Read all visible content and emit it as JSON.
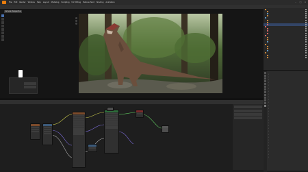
{
  "menubar": {
    "items": [
      "File",
      "Edit",
      "Render",
      "Window",
      "Help",
      "Layout",
      "Modeling",
      "Sculpting",
      "UV Editing",
      "Texture Paint",
      "Shading",
      "Animation"
    ]
  },
  "window_controls": {
    "minimize": "–",
    "maximize": "□",
    "close": "×"
  },
  "viewport": {
    "title": "Camera Perspective"
  },
  "minipanel": {
    "row1_label": "",
    "row2_value": "",
    "row3_value": ""
  },
  "node_editor": {
    "header_labels": [
      "",
      ""
    ]
  },
  "outliner": {
    "rows": [
      {
        "label": "",
        "color": "#d08b3b",
        "selected": false
      },
      {
        "label": "",
        "color": "#d08b3b",
        "selected": false
      },
      {
        "label": "",
        "color": "#5fa0d0",
        "selected": false
      },
      {
        "label": "",
        "color": "#d08b3b",
        "selected": false
      },
      {
        "label": "",
        "color": "#5fa0d0",
        "selected": false
      },
      {
        "label": "",
        "color": "#d08b3b",
        "selected": false
      },
      {
        "label": "",
        "color": "#d08b3b",
        "selected": false
      },
      {
        "label": "",
        "color": "#e06a6a",
        "selected": true
      },
      {
        "label": "",
        "color": "#e06a6a",
        "selected": false
      },
      {
        "label": "",
        "color": "#e06a6a",
        "selected": false
      },
      {
        "label": "",
        "color": "#e06a6a",
        "selected": false
      },
      {
        "label": "",
        "color": "#e06a6a",
        "selected": false
      },
      {
        "label": "",
        "color": "#e06a6a",
        "selected": false
      },
      {
        "label": "",
        "color": "#d08b3b",
        "selected": false
      },
      {
        "label": "",
        "color": "#d08b3b",
        "selected": false
      },
      {
        "label": "",
        "color": "#5fa0d0",
        "selected": false
      },
      {
        "label": "",
        "color": "#d08b3b",
        "selected": false
      },
      {
        "label": "",
        "color": "#d08b3b",
        "selected": false
      },
      {
        "label": "",
        "color": "#d08b3b",
        "selected": false
      },
      {
        "label": "",
        "color": "#5fa0d0",
        "selected": false
      },
      {
        "label": "",
        "color": "#d08b3b",
        "selected": false
      },
      {
        "label": "",
        "color": "#d08b3b",
        "selected": false
      },
      {
        "label": "",
        "color": "#d08b3b",
        "selected": false
      }
    ]
  },
  "properties": {
    "rows": [
      "",
      "",
      "",
      "",
      "",
      "",
      "",
      "",
      "",
      "",
      "",
      "",
      "",
      "",
      "",
      "",
      "",
      "",
      "",
      "",
      "",
      "",
      "",
      "",
      "",
      "",
      "",
      "",
      "",
      ""
    ]
  },
  "colors": {
    "accent": "#4a72b0",
    "blender_orange": "#e87d0d",
    "selection": "#334566"
  }
}
